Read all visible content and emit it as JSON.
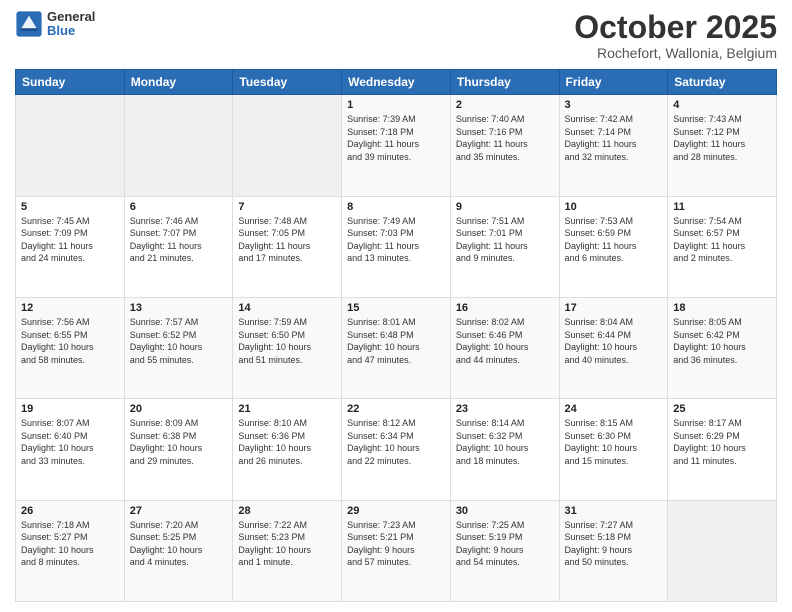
{
  "header": {
    "logo": {
      "general": "General",
      "blue": "Blue"
    },
    "title": "October 2025",
    "location": "Rochefort, Wallonia, Belgium"
  },
  "weekdays": [
    "Sunday",
    "Monday",
    "Tuesday",
    "Wednesday",
    "Thursday",
    "Friday",
    "Saturday"
  ],
  "weeks": [
    [
      {
        "day": "",
        "info": ""
      },
      {
        "day": "",
        "info": ""
      },
      {
        "day": "",
        "info": ""
      },
      {
        "day": "1",
        "info": "Sunrise: 7:39 AM\nSunset: 7:18 PM\nDaylight: 11 hours\nand 39 minutes."
      },
      {
        "day": "2",
        "info": "Sunrise: 7:40 AM\nSunset: 7:16 PM\nDaylight: 11 hours\nand 35 minutes."
      },
      {
        "day": "3",
        "info": "Sunrise: 7:42 AM\nSunset: 7:14 PM\nDaylight: 11 hours\nand 32 minutes."
      },
      {
        "day": "4",
        "info": "Sunrise: 7:43 AM\nSunset: 7:12 PM\nDaylight: 11 hours\nand 28 minutes."
      }
    ],
    [
      {
        "day": "5",
        "info": "Sunrise: 7:45 AM\nSunset: 7:09 PM\nDaylight: 11 hours\nand 24 minutes."
      },
      {
        "day": "6",
        "info": "Sunrise: 7:46 AM\nSunset: 7:07 PM\nDaylight: 11 hours\nand 21 minutes."
      },
      {
        "day": "7",
        "info": "Sunrise: 7:48 AM\nSunset: 7:05 PM\nDaylight: 11 hours\nand 17 minutes."
      },
      {
        "day": "8",
        "info": "Sunrise: 7:49 AM\nSunset: 7:03 PM\nDaylight: 11 hours\nand 13 minutes."
      },
      {
        "day": "9",
        "info": "Sunrise: 7:51 AM\nSunset: 7:01 PM\nDaylight: 11 hours\nand 9 minutes."
      },
      {
        "day": "10",
        "info": "Sunrise: 7:53 AM\nSunset: 6:59 PM\nDaylight: 11 hours\nand 6 minutes."
      },
      {
        "day": "11",
        "info": "Sunrise: 7:54 AM\nSunset: 6:57 PM\nDaylight: 11 hours\nand 2 minutes."
      }
    ],
    [
      {
        "day": "12",
        "info": "Sunrise: 7:56 AM\nSunset: 6:55 PM\nDaylight: 10 hours\nand 58 minutes."
      },
      {
        "day": "13",
        "info": "Sunrise: 7:57 AM\nSunset: 6:52 PM\nDaylight: 10 hours\nand 55 minutes."
      },
      {
        "day": "14",
        "info": "Sunrise: 7:59 AM\nSunset: 6:50 PM\nDaylight: 10 hours\nand 51 minutes."
      },
      {
        "day": "15",
        "info": "Sunrise: 8:01 AM\nSunset: 6:48 PM\nDaylight: 10 hours\nand 47 minutes."
      },
      {
        "day": "16",
        "info": "Sunrise: 8:02 AM\nSunset: 6:46 PM\nDaylight: 10 hours\nand 44 minutes."
      },
      {
        "day": "17",
        "info": "Sunrise: 8:04 AM\nSunset: 6:44 PM\nDaylight: 10 hours\nand 40 minutes."
      },
      {
        "day": "18",
        "info": "Sunrise: 8:05 AM\nSunset: 6:42 PM\nDaylight: 10 hours\nand 36 minutes."
      }
    ],
    [
      {
        "day": "19",
        "info": "Sunrise: 8:07 AM\nSunset: 6:40 PM\nDaylight: 10 hours\nand 33 minutes."
      },
      {
        "day": "20",
        "info": "Sunrise: 8:09 AM\nSunset: 6:38 PM\nDaylight: 10 hours\nand 29 minutes."
      },
      {
        "day": "21",
        "info": "Sunrise: 8:10 AM\nSunset: 6:36 PM\nDaylight: 10 hours\nand 26 minutes."
      },
      {
        "day": "22",
        "info": "Sunrise: 8:12 AM\nSunset: 6:34 PM\nDaylight: 10 hours\nand 22 minutes."
      },
      {
        "day": "23",
        "info": "Sunrise: 8:14 AM\nSunset: 6:32 PM\nDaylight: 10 hours\nand 18 minutes."
      },
      {
        "day": "24",
        "info": "Sunrise: 8:15 AM\nSunset: 6:30 PM\nDaylight: 10 hours\nand 15 minutes."
      },
      {
        "day": "25",
        "info": "Sunrise: 8:17 AM\nSunset: 6:29 PM\nDaylight: 10 hours\nand 11 minutes."
      }
    ],
    [
      {
        "day": "26",
        "info": "Sunrise: 7:18 AM\nSunset: 5:27 PM\nDaylight: 10 hours\nand 8 minutes."
      },
      {
        "day": "27",
        "info": "Sunrise: 7:20 AM\nSunset: 5:25 PM\nDaylight: 10 hours\nand 4 minutes."
      },
      {
        "day": "28",
        "info": "Sunrise: 7:22 AM\nSunset: 5:23 PM\nDaylight: 10 hours\nand 1 minute."
      },
      {
        "day": "29",
        "info": "Sunrise: 7:23 AM\nSunset: 5:21 PM\nDaylight: 9 hours\nand 57 minutes."
      },
      {
        "day": "30",
        "info": "Sunrise: 7:25 AM\nSunset: 5:19 PM\nDaylight: 9 hours\nand 54 minutes."
      },
      {
        "day": "31",
        "info": "Sunrise: 7:27 AM\nSunset: 5:18 PM\nDaylight: 9 hours\nand 50 minutes."
      },
      {
        "day": "",
        "info": ""
      }
    ]
  ]
}
